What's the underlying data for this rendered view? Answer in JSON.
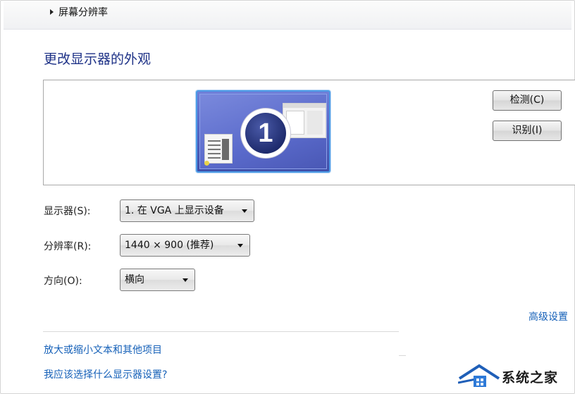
{
  "breadcrumb": {
    "label": "屏幕分辨率"
  },
  "page_title": "更改显示器的外观",
  "buttons": {
    "detect": "检测(C)",
    "identify": "识别(I)"
  },
  "monitor": {
    "number": "1"
  },
  "form": {
    "display_label": "显示器(S):",
    "display_value": "1. 在 VGA 上显示设备",
    "resolution_label": "分辨率(R):",
    "resolution_value": "1440 × 900 (推荐)",
    "orientation_label": "方向(O):",
    "orientation_value": "横向"
  },
  "links": {
    "advanced": "高级设置",
    "enlarge_text": "放大或缩小文本和其他项目",
    "which_settings": "我应该选择什么显示器设置?"
  },
  "watermark": {
    "text": "系统之家"
  },
  "colors": {
    "title": "#1e3287",
    "link": "#1560b8",
    "monitor_border": "#4c9be6"
  }
}
